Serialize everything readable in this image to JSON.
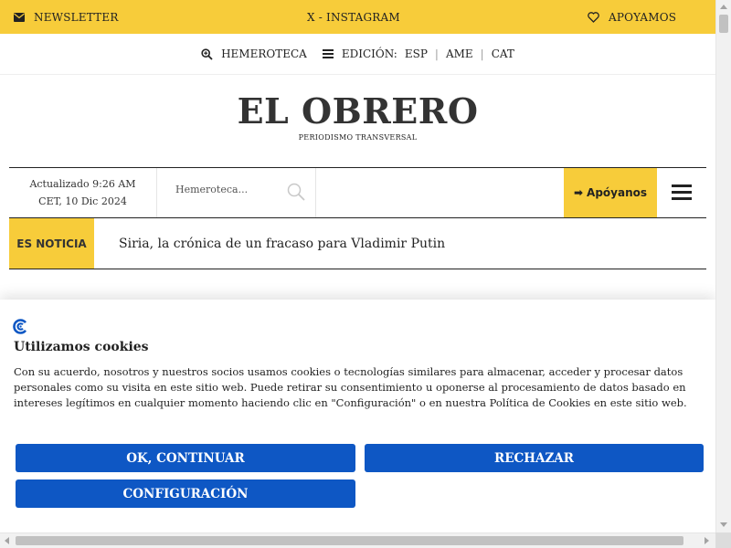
{
  "topbar": {
    "newsletter_label": "NEWSLETTER",
    "social_label": "X - INSTAGRAM",
    "support_label": "APOYAMOS",
    "background": "#f7cc3a"
  },
  "edition_bar": {
    "archive_label": "HEMEROTECA",
    "edition_label": "EDICIÓN:",
    "editions": [
      "ESP",
      "AME",
      "CAT"
    ]
  },
  "masthead": {
    "title": "EL OBRERO",
    "tagline": "PERIODISMO TRANSVERSAL"
  },
  "nav": {
    "updated_line1": "Actualizado 9:26 AM",
    "updated_line2": "CET, 10 Dic 2024",
    "search_placeholder": "Hemeroteca...",
    "support_label": "Apóyanos",
    "support_arrow": "➡"
  },
  "breaking": {
    "tag": "ES NOTICIA",
    "headline": "Siria, la crónica de un fracaso para Vladimir Putin"
  },
  "cookie": {
    "title": "Utilizamos cookies",
    "text": "Con su acuerdo, nosotros y nuestros socios usamos cookies o tecnologías similares para almacenar, acceder y procesar datos personales como su visita en este sitio web. Puede retirar su consentimiento u oponerse al procesamiento de datos basado en intereses legítimos en cualquier momento haciendo clic en \"Configuración\" o en nuestra Política de Cookies en este sitio web.",
    "accept_label": "OK, CONTINUAR",
    "reject_label": "RECHAZAR",
    "config_label": "CONFIGURACIÓN",
    "button_color": "#0e57c4"
  }
}
